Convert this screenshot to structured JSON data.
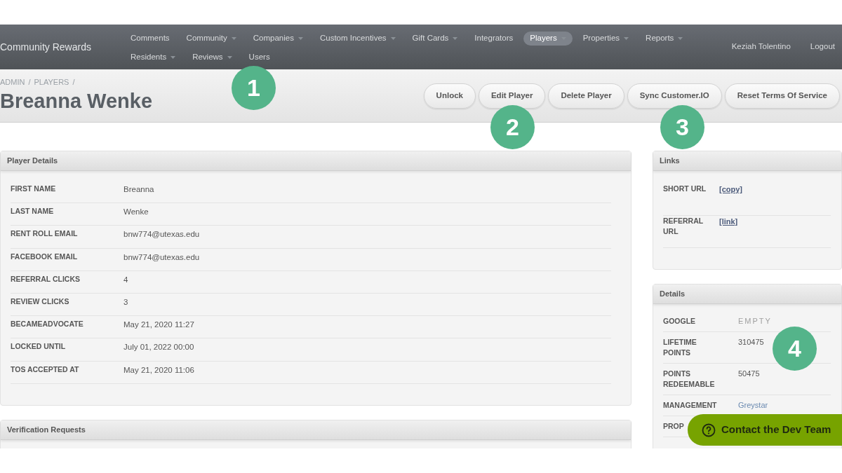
{
  "navbar": {
    "brand": "Community Rewards",
    "items": [
      {
        "label": "Comments",
        "dropdown": false,
        "selected": false
      },
      {
        "label": "Community",
        "dropdown": true,
        "selected": false
      },
      {
        "label": "Companies",
        "dropdown": true,
        "selected": false
      },
      {
        "label": "Custom Incentives",
        "dropdown": true,
        "selected": false
      },
      {
        "label": "Gift Cards",
        "dropdown": true,
        "selected": false
      },
      {
        "label": "Integrators",
        "dropdown": false,
        "selected": false
      },
      {
        "label": "Players",
        "dropdown": true,
        "selected": true
      },
      {
        "label": "Properties",
        "dropdown": true,
        "selected": false
      },
      {
        "label": "Reports",
        "dropdown": true,
        "selected": false
      },
      {
        "label": "Residents",
        "dropdown": true,
        "selected": false
      },
      {
        "label": "Reviews",
        "dropdown": true,
        "selected": false
      },
      {
        "label": "Users",
        "dropdown": false,
        "selected": false
      }
    ],
    "user": "Keziah Tolentino",
    "logout": "Logout"
  },
  "breadcrumb": {
    "items": [
      "ADMIN",
      "PLAYERS"
    ],
    "separator": "/"
  },
  "page_title": "Breanna Wenke",
  "actions": [
    "Unlock",
    "Edit Player",
    "Delete Player",
    "Sync Customer.IO",
    "Reset Terms Of Service"
  ],
  "player_details": {
    "title": "Player Details",
    "rows": [
      {
        "label": "FIRST NAME",
        "value": "Breanna"
      },
      {
        "label": "LAST NAME",
        "value": "Wenke"
      },
      {
        "label": "RENT ROLL EMAIL",
        "value": "bnw774@utexas.edu"
      },
      {
        "label": "FACEBOOK EMAIL",
        "value": "bnw774@utexas.edu"
      },
      {
        "label": "REFERRAL CLICKS",
        "value": "4"
      },
      {
        "label": "REVIEW CLICKS",
        "value": "3"
      },
      {
        "label": "BECAMEADVOCATE",
        "value": "May 21, 2020 11:27"
      },
      {
        "label": "LOCKED UNTIL",
        "value": "July 01, 2022 00:00"
      },
      {
        "label": "TOS ACCEPTED AT",
        "value": "May 21, 2020 11:06"
      }
    ]
  },
  "verification_requests": {
    "title": "Verification Requests"
  },
  "links": {
    "title": "Links",
    "rows": [
      {
        "label": "SHORT URL",
        "value": "[copy]",
        "kind": "link"
      },
      {
        "label": "REFERRAL URL",
        "value": "[link]",
        "kind": "link"
      }
    ]
  },
  "details": {
    "title": "Details",
    "rows": [
      {
        "label": "GOOGLE",
        "value": "EMPTY",
        "kind": "empty"
      },
      {
        "label": "LIFETIME POINTS",
        "value": "310475",
        "kind": "text"
      },
      {
        "label": "POINTS REDEEMABLE",
        "value": "50475",
        "kind": "text"
      },
      {
        "label": "MANAGEMENT",
        "value": "Greystar",
        "kind": "company"
      },
      {
        "label": "PROP"
      }
    ]
  },
  "contact_button": "Contact the Dev Team",
  "callouts": [
    "1",
    "2",
    "3",
    "4"
  ]
}
